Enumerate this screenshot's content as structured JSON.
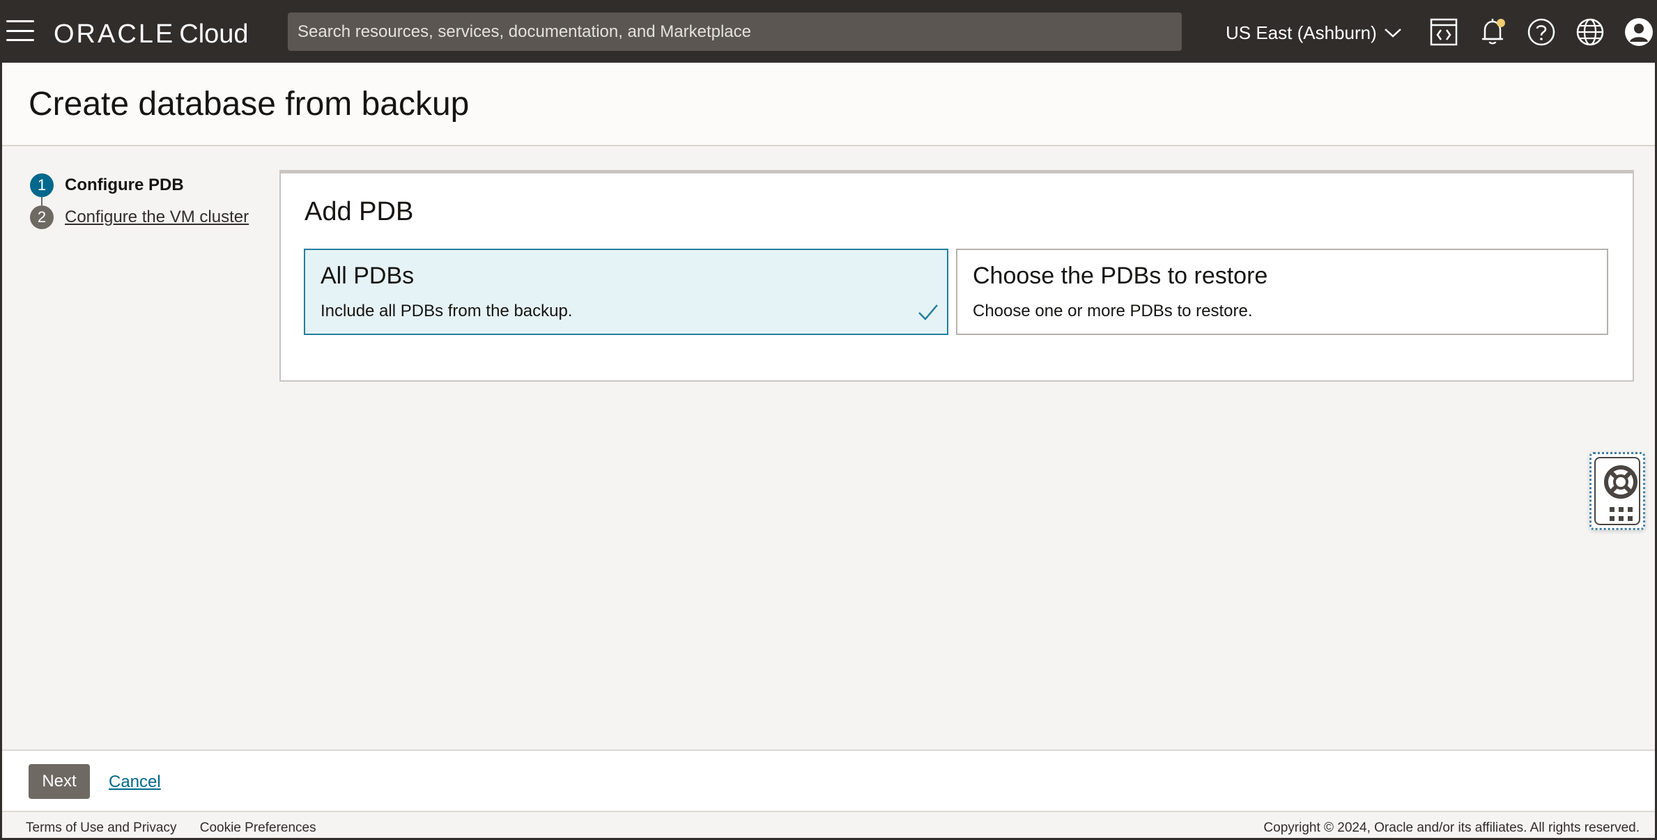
{
  "header": {
    "brand": "ORACLE",
    "product": "Cloud",
    "search_placeholder": "Search resources, services, documentation, and Marketplace",
    "region": "US East (Ashburn)",
    "icons": [
      "menu-icon",
      "code-editor-icon",
      "bell-icon",
      "help-icon",
      "globe-icon",
      "user-icon"
    ],
    "notification_dot_color": "#f0cc71"
  },
  "page": {
    "title": "Create database from backup"
  },
  "steps": [
    {
      "number": "1",
      "label": "Configure PDB",
      "state": "active"
    },
    {
      "number": "2",
      "label": "Configure the VM cluster",
      "state": "link"
    }
  ],
  "card": {
    "title": "Add PDB",
    "options": [
      {
        "title": "All PDBs",
        "description": "Include all PDBs from the backup.",
        "selected": true
      },
      {
        "title": "Choose the PDBs to restore",
        "description": "Choose one or more PDBs to restore.",
        "selected": false
      }
    ]
  },
  "actions": {
    "next": "Next",
    "cancel": "Cancel"
  },
  "footer": {
    "terms": "Terms of Use and Privacy",
    "cookies": "Cookie Preferences",
    "copyright": "Copyright © 2024, Oracle and/or its affiliates. All rights reserved."
  },
  "colors": {
    "header_bg": "#312d2a",
    "accent": "#00688c",
    "selected_bg": "#e6f3f6"
  }
}
